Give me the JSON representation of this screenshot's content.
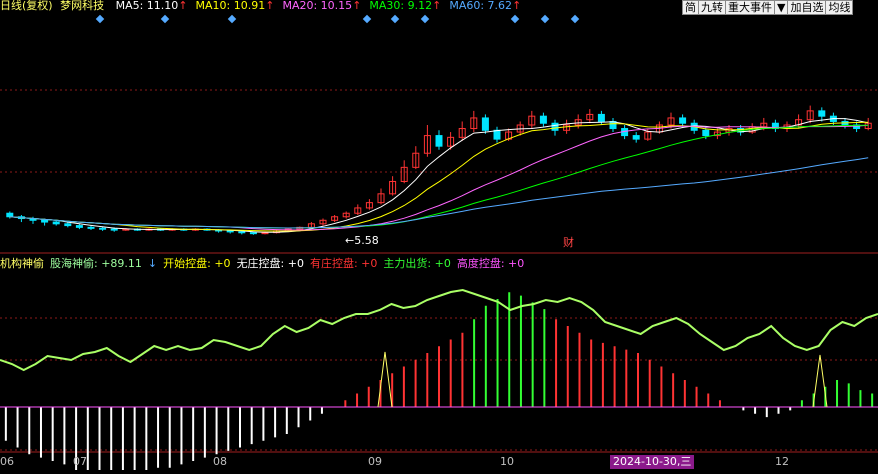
{
  "header": {
    "name_prefix": "日线(复权)",
    "name": "梦网科技",
    "ma": [
      {
        "label": "MA5: 11.10",
        "color": "#ffffff"
      },
      {
        "label": "MA10: 10.91",
        "color": "#ffff00"
      },
      {
        "label": "MA20: 10.15",
        "color": "#ff66ff"
      },
      {
        "label": "MA30: 9.12",
        "color": "#00ff00"
      },
      {
        "label": "MA60: 7.62",
        "color": "#55aaff"
      }
    ],
    "arrow": "↑",
    "arrow_color": "#ff3333"
  },
  "toolbar": {
    "items": [
      "简",
      "九转",
      "重大事件",
      "▼",
      "加自选",
      "均线"
    ]
  },
  "indicator_header": {
    "items": [
      {
        "text": "机构神偷",
        "color": "#ffff66"
      },
      {
        "text": "股海神偷: +89.11",
        "color": "#9fff9f"
      },
      {
        "text": "↓",
        "color": "#55aaff"
      },
      {
        "text": "开始控盘: +0",
        "color": "#ffff00"
      },
      {
        "text": "无庄控盘: +0",
        "color": "#ffffff"
      },
      {
        "text": "有庄控盘: +0",
        "color": "#ff3333"
      },
      {
        "text": "主力出货: +0",
        "color": "#33ff33"
      },
      {
        "text": "高度控盘: +0",
        "color": "#ff55ff"
      }
    ]
  },
  "annotations": {
    "low_label": "←5.58",
    "finance_mark": "财"
  },
  "xaxis": {
    "labels": [
      "06",
      "07",
      "08",
      "09",
      "10",
      "2024-10-30,三",
      "12"
    ]
  },
  "colors": {
    "up": "#ff3333",
    "down": "#00e5ff",
    "ma5": "#ffffff",
    "ma10": "#ffff00",
    "ma20": "#ff66ff",
    "ma30": "#00ff00",
    "ma60": "#55aaff",
    "oscillator": "#aaff66",
    "grid": "#8b1a1a"
  },
  "chart_data": {
    "type": "line",
    "series": [
      {
        "name": "股海神偷",
        "values": [
          5,
          3,
          0,
          3,
          7,
          6,
          5,
          8,
          9,
          11,
          7,
          4,
          8,
          12,
          10,
          12,
          10,
          11,
          15,
          14,
          12,
          10,
          12,
          18,
          22,
          19,
          21,
          25,
          23,
          26,
          28,
          28,
          30,
          33,
          31,
          32,
          35,
          37,
          39,
          40,
          38,
          36,
          34,
          30,
          32,
          33,
          35,
          34,
          36,
          34,
          30,
          24,
          22,
          20,
          18,
          22,
          24,
          26,
          23,
          18,
          14,
          10,
          12,
          16,
          18,
          22,
          16,
          12,
          10,
          12,
          20,
          24,
          22,
          26,
          28
        ]
      },
      {
        "name": "开始控盘",
        "values": [
          0,
          0,
          0,
          0,
          0,
          0,
          0,
          0,
          0,
          0,
          0,
          0,
          0,
          0,
          0,
          0,
          0,
          0,
          0,
          0,
          0,
          0,
          0,
          0,
          0,
          0,
          0,
          0,
          0,
          0,
          0,
          0,
          0,
          0,
          0,
          0,
          0,
          0,
          0,
          0,
          0,
          0,
          0,
          0,
          0,
          0,
          0,
          0,
          0,
          0,
          0,
          0,
          0,
          0,
          0,
          0,
          0,
          0,
          0,
          0,
          0,
          0,
          0,
          0,
          0,
          0,
          0,
          0,
          0,
          0,
          0,
          0,
          0,
          0,
          0
        ]
      },
      {
        "name": "无庄控盘",
        "values": [
          0,
          0,
          0,
          0,
          0,
          0,
          0,
          0,
          0,
          0,
          0,
          0,
          0,
          0,
          0,
          0,
          0,
          0,
          0,
          0,
          0,
          0,
          0,
          0,
          0,
          0,
          0,
          0,
          0,
          0,
          0,
          0,
          0,
          0,
          0,
          0,
          0,
          0,
          0,
          0,
          0,
          0,
          0,
          0,
          0,
          0,
          0,
          0,
          0,
          0,
          0,
          0,
          0,
          0,
          0,
          0,
          0,
          0,
          0,
          0,
          0,
          0,
          0,
          0,
          0,
          0,
          0,
          0,
          0,
          0,
          0,
          0,
          0,
          0,
          0
        ]
      },
      {
        "name": "有庄控盘",
        "values": [
          0,
          0,
          0,
          0,
          0,
          0,
          0,
          0,
          0,
          0,
          0,
          0,
          0,
          0,
          0,
          0,
          0,
          0,
          0,
          0,
          0,
          0,
          0,
          0,
          0,
          0,
          0,
          0,
          0,
          0,
          0,
          0,
          0,
          0,
          0,
          0,
          0,
          0,
          0,
          0,
          0,
          0,
          0,
          0,
          0,
          0,
          0,
          0,
          0,
          0,
          0,
          0,
          0,
          0,
          0,
          0,
          0,
          0,
          0,
          0,
          0,
          0,
          0,
          0,
          0,
          0,
          0,
          0,
          0,
          0,
          0,
          0,
          0,
          0,
          0
        ]
      },
      {
        "name": "主力出货",
        "values": [
          0,
          0,
          0,
          0,
          0,
          0,
          0,
          0,
          0,
          0,
          0,
          0,
          0,
          0,
          0,
          0,
          0,
          0,
          0,
          0,
          0,
          0,
          0,
          0,
          0,
          0,
          0,
          0,
          0,
          0,
          0,
          0,
          0,
          0,
          0,
          0,
          0,
          0,
          0,
          0,
          0,
          0,
          0,
          0,
          0,
          0,
          0,
          0,
          0,
          0,
          0,
          0,
          0,
          0,
          0,
          0,
          0,
          0,
          0,
          0,
          0,
          0,
          0,
          0,
          0,
          0,
          0,
          0,
          0,
          0,
          0,
          0,
          0,
          0,
          0
        ]
      },
      {
        "name": "高度控盘",
        "values": [
          0,
          0,
          0,
          0,
          0,
          0,
          0,
          0,
          0,
          0,
          0,
          0,
          0,
          0,
          0,
          0,
          0,
          0,
          0,
          0,
          0,
          0,
          0,
          0,
          0,
          0,
          0,
          0,
          0,
          0,
          0,
          0,
          0,
          0,
          0,
          0,
          0,
          0,
          0,
          0,
          0,
          0,
          0,
          0,
          0,
          0,
          0,
          0,
          0,
          0,
          0,
          0,
          0,
          0,
          0,
          0,
          0,
          0,
          0,
          0,
          0,
          0,
          0,
          0,
          0,
          0,
          0,
          0,
          0,
          0,
          0,
          0,
          0,
          0,
          0
        ]
      }
    ],
    "histogram": [
      -10,
      -12,
      -14,
      -15,
      -16,
      -17,
      -19,
      -21,
      -22,
      -23,
      -22,
      -20,
      -19,
      -18,
      -18,
      -17,
      -16,
      -15,
      -14,
      -13,
      -12,
      -11,
      -10,
      -9,
      -8,
      -6,
      -4,
      -2,
      0,
      2,
      4,
      6,
      8,
      10,
      12,
      14,
      16,
      18,
      20,
      22,
      26,
      30,
      32,
      34,
      33,
      31,
      29,
      26,
      24,
      22,
      20,
      19,
      18,
      17,
      16,
      14,
      12,
      10,
      8,
      6,
      4,
      2,
      0,
      -1,
      -2,
      -3,
      -2,
      -1,
      2,
      4,
      6,
      8,
      7,
      5,
      4
    ],
    "candles": [
      [
        6.8,
        6.6,
        6.5,
        6.9
      ],
      [
        6.6,
        6.5,
        6.3,
        6.7
      ],
      [
        6.5,
        6.4,
        6.2,
        6.6
      ],
      [
        6.4,
        6.3,
        6.1,
        6.5
      ],
      [
        6.3,
        6.2,
        6.1,
        6.4
      ],
      [
        6.2,
        6.1,
        6.0,
        6.3
      ],
      [
        6.1,
        6.0,
        5.9,
        6.2
      ],
      [
        6.0,
        5.95,
        5.85,
        6.1
      ],
      [
        5.95,
        5.9,
        5.8,
        6.05
      ],
      [
        5.9,
        5.85,
        5.75,
        6.0
      ],
      [
        5.85,
        5.9,
        5.8,
        5.95
      ],
      [
        5.9,
        5.85,
        5.8,
        5.95
      ],
      [
        5.85,
        5.9,
        5.8,
        5.95
      ],
      [
        5.9,
        5.85,
        5.8,
        5.95
      ],
      [
        5.85,
        5.9,
        5.8,
        5.95
      ],
      [
        5.9,
        5.88,
        5.8,
        5.95
      ],
      [
        5.88,
        5.9,
        5.8,
        5.95
      ],
      [
        5.9,
        5.85,
        5.8,
        5.95
      ],
      [
        5.85,
        5.8,
        5.7,
        5.9
      ],
      [
        5.8,
        5.75,
        5.65,
        5.85
      ],
      [
        5.75,
        5.7,
        5.6,
        5.8
      ],
      [
        5.7,
        5.65,
        5.58,
        5.75
      ],
      [
        5.65,
        5.7,
        5.6,
        5.75
      ],
      [
        5.7,
        5.8,
        5.65,
        5.85
      ],
      [
        5.8,
        5.9,
        5.75,
        5.95
      ],
      [
        5.9,
        6.0,
        5.85,
        6.05
      ],
      [
        6.0,
        6.2,
        5.95,
        6.3
      ],
      [
        6.2,
        6.4,
        6.1,
        6.5
      ],
      [
        6.4,
        6.6,
        6.3,
        6.7
      ],
      [
        6.6,
        6.8,
        6.5,
        6.9
      ],
      [
        6.8,
        7.1,
        6.7,
        7.3
      ],
      [
        7.1,
        7.4,
        7.0,
        7.6
      ],
      [
        7.4,
        7.9,
        7.3,
        8.2
      ],
      [
        7.9,
        8.6,
        7.8,
        8.9
      ],
      [
        8.6,
        9.4,
        8.5,
        9.8
      ],
      [
        9.4,
        10.2,
        9.3,
        10.6
      ],
      [
        10.2,
        11.2,
        10.0,
        11.8
      ],
      [
        11.2,
        10.6,
        10.4,
        11.5
      ],
      [
        10.6,
        11.1,
        10.4,
        11.4
      ],
      [
        11.1,
        11.6,
        10.9,
        12.0
      ],
      [
        11.6,
        12.2,
        11.4,
        12.6
      ],
      [
        12.2,
        11.5,
        11.3,
        12.4
      ],
      [
        11.5,
        11.0,
        10.8,
        11.7
      ],
      [
        11.0,
        11.4,
        10.9,
        11.6
      ],
      [
        11.4,
        11.8,
        11.2,
        12.0
      ],
      [
        11.8,
        12.3,
        11.6,
        12.6
      ],
      [
        12.3,
        11.9,
        11.7,
        12.5
      ],
      [
        11.9,
        11.5,
        11.2,
        12.1
      ],
      [
        11.5,
        11.8,
        11.3,
        12.1
      ],
      [
        11.8,
        12.1,
        11.6,
        12.4
      ],
      [
        12.1,
        12.4,
        11.9,
        12.7
      ],
      [
        12.4,
        12.0,
        11.8,
        12.6
      ],
      [
        12.0,
        11.6,
        11.4,
        12.2
      ],
      [
        11.6,
        11.2,
        11.0,
        11.8
      ],
      [
        11.2,
        11.0,
        10.8,
        11.4
      ],
      [
        11.0,
        11.4,
        10.9,
        11.6
      ],
      [
        11.4,
        11.8,
        11.3,
        12.0
      ],
      [
        11.8,
        12.2,
        11.6,
        12.5
      ],
      [
        12.2,
        11.9,
        11.7,
        12.4
      ],
      [
        11.9,
        11.5,
        11.3,
        12.1
      ],
      [
        11.5,
        11.2,
        11.0,
        11.7
      ],
      [
        11.2,
        11.4,
        11.0,
        11.6
      ],
      [
        11.4,
        11.6,
        11.2,
        11.8
      ],
      [
        11.6,
        11.4,
        11.2,
        11.8
      ],
      [
        11.4,
        11.7,
        11.3,
        11.9
      ],
      [
        11.7,
        11.9,
        11.5,
        12.2
      ],
      [
        11.9,
        11.6,
        11.4,
        12.1
      ],
      [
        11.6,
        11.8,
        11.4,
        12.0
      ],
      [
        11.8,
        12.1,
        11.6,
        12.4
      ],
      [
        12.1,
        12.6,
        11.9,
        12.9
      ],
      [
        12.6,
        12.3,
        12.0,
        12.8
      ],
      [
        12.3,
        12.0,
        11.8,
        12.5
      ],
      [
        12.0,
        11.8,
        11.6,
        12.2
      ],
      [
        11.8,
        11.6,
        11.4,
        12.0
      ],
      [
        11.6,
        11.9,
        11.5,
        12.2
      ]
    ],
    "price_range": [
      5.0,
      13.5
    ],
    "osc_range": [
      -10,
      45
    ],
    "hist_range": [
      -25,
      40
    ]
  }
}
